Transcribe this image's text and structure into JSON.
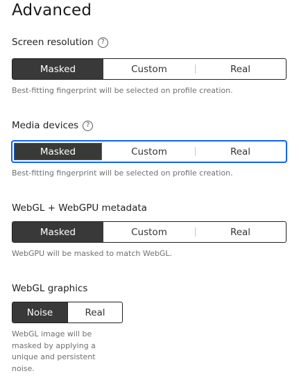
{
  "title": "Advanced",
  "screen_resolution": {
    "label": "Screen resolution",
    "help_icon": "question-circle-icon",
    "options": [
      "Masked",
      "Custom",
      "Real"
    ],
    "selected": "Masked",
    "helper": "Best-fitting fingerprint will be selected on profile creation."
  },
  "media_devices": {
    "label": "Media devices",
    "help_icon": "question-circle-icon",
    "options": [
      "Masked",
      "Custom",
      "Real"
    ],
    "selected": "Masked",
    "helper": "Best-fitting fingerprint will be selected on profile creation."
  },
  "webgl_metadata": {
    "label": "WebGL + WebGPU metadata",
    "options": [
      "Masked",
      "Custom",
      "Real"
    ],
    "selected": "Masked",
    "helper": "WebGPU will be masked to match WebGL."
  },
  "webgl_graphics": {
    "label": "WebGL graphics",
    "options": [
      "Noise",
      "Real"
    ],
    "selected": "Noise",
    "helper_lines": [
      "WebGL image will be",
      "masked by applying a",
      "unique and persistent",
      "noise."
    ]
  },
  "colors": {
    "active_bg": "#393939",
    "focus": "#0f62fe",
    "helper_text": "#6f6f6f"
  }
}
